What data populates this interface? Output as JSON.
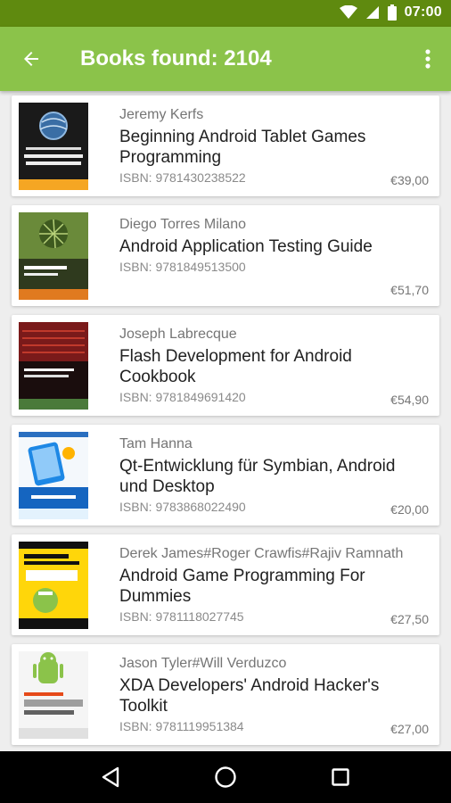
{
  "status_bar": {
    "time": "07:00",
    "icons": [
      "wifi-icon",
      "signal-icon",
      "battery-icon"
    ],
    "background": "#5f8a0f"
  },
  "app_bar": {
    "title": "Books found: 2104",
    "back_icon": "arrow-back-icon",
    "menu_icon": "more-vert-icon",
    "background": "#8bc34a"
  },
  "books": [
    {
      "author": "Jeremy Kerfs",
      "title": "Beginning Android Tablet Games Programming",
      "isbn": "ISBN: 9781430238522",
      "price": "€39,00",
      "cover_text": "Beginning Android Tablet Games Programming"
    },
    {
      "author": "Diego Torres Milano",
      "title": "Android Application Testing Guide",
      "isbn": "ISBN: 9781849513500",
      "price": "€51,70",
      "cover_text": "Android Application Testing Guide"
    },
    {
      "author": "Joseph Labrecque",
      "title": "Flash Development for Android Cookbook",
      "isbn": "ISBN: 9781849691420",
      "price": "€54,90",
      "cover_text": "Flash Development for Android Cookbook"
    },
    {
      "author": "Tam Hanna",
      "title": "Qt-Entwicklung für Symbian, Android und Desktop",
      "isbn": "ISBN: 9783868022490",
      "price": "€20,00",
      "cover_text": "Qt-Entwicklung"
    },
    {
      "author": "Derek James#Roger Crawfis#Rajiv Ramnath",
      "title": "Android Game Programming For Dummies",
      "isbn": "ISBN: 9781118027745",
      "price": "€27,50",
      "cover_text": "Android Game Programming"
    },
    {
      "author": "Jason Tyler#Will Verduzco",
      "title": "XDA Developers' Android Hacker's Toolkit",
      "isbn": "ISBN: 9781119951384",
      "price": "€27,00",
      "cover_text": "ANDROID HACKER'S TOOLKIT"
    }
  ],
  "nav_bar": {
    "buttons": [
      "back-triangle-icon",
      "home-circle-icon",
      "recents-square-icon"
    ]
  }
}
